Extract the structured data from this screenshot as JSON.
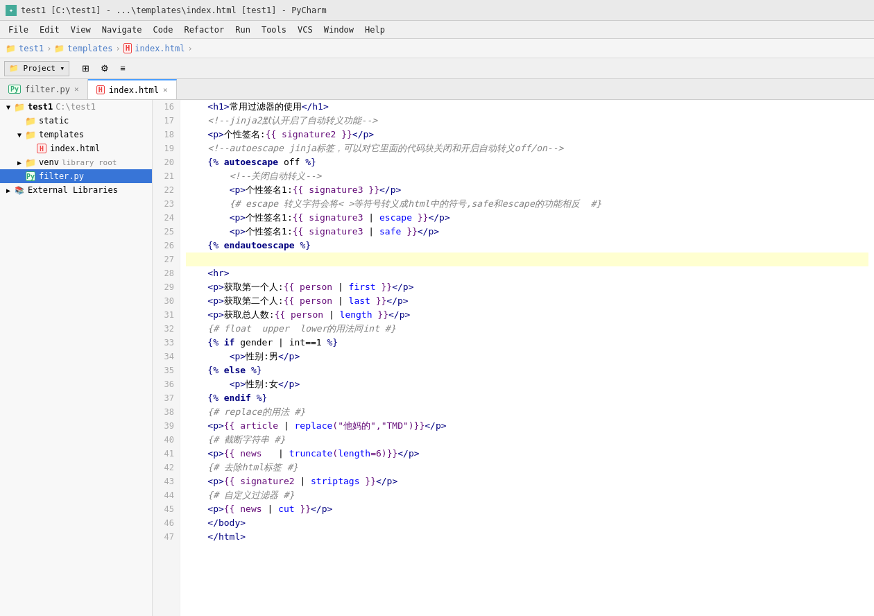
{
  "window": {
    "title": "test1 [C:\\test1] - ...\\templates\\index.html [test1] - PyCharm"
  },
  "menu": {
    "items": [
      "File",
      "Edit",
      "View",
      "Navigate",
      "Code",
      "Refactor",
      "Run",
      "Tools",
      "VCS",
      "Window",
      "Help"
    ]
  },
  "breadcrumbs": [
    "test1",
    "templates",
    "index.html"
  ],
  "toolbar": {
    "project_label": "Project",
    "tabs": [
      {
        "label": "filter.py",
        "active": false,
        "closable": true
      },
      {
        "label": "index.html",
        "active": true,
        "closable": true
      }
    ]
  },
  "sidebar": {
    "items": [
      {
        "indent": 0,
        "arrow": "▼",
        "icon": "folder",
        "label": "test1",
        "suffix": "C:\\test1",
        "selected": false
      },
      {
        "indent": 1,
        "arrow": "",
        "icon": "folder",
        "label": "static",
        "suffix": "",
        "selected": false
      },
      {
        "indent": 1,
        "arrow": "▼",
        "icon": "folder",
        "label": "templates",
        "suffix": "",
        "selected": false
      },
      {
        "indent": 2,
        "arrow": "",
        "icon": "html",
        "label": "index.html",
        "suffix": "",
        "selected": false
      },
      {
        "indent": 1,
        "arrow": "▶",
        "icon": "folder",
        "label": "venv",
        "suffix": "library root",
        "selected": false
      },
      {
        "indent": 1,
        "arrow": "",
        "icon": "py",
        "label": "filter.py",
        "suffix": "",
        "selected": true
      },
      {
        "indent": 0,
        "arrow": "▶",
        "icon": "libs",
        "label": "External Libraries",
        "suffix": "",
        "selected": false
      }
    ]
  },
  "code": {
    "lines": [
      {
        "num": 16,
        "content": "    <h1>常用过滤器的使用</h1>",
        "type": "html",
        "highlighted": false
      },
      {
        "num": 17,
        "content": "    <!--jinja2默认开启了自动转义功能-->",
        "type": "comment",
        "highlighted": false
      },
      {
        "num": 18,
        "content": "    <p>个性签名:{{ signature2 }}</p>",
        "type": "html",
        "highlighted": false
      },
      {
        "num": 19,
        "content": "    <!--autoescape jinja标签，可以对它里面的代码块关闭和开启自动转义off/on-->",
        "type": "comment",
        "highlighted": false
      },
      {
        "num": 20,
        "content": "    {% autoescape off %}",
        "type": "jinja",
        "highlighted": false
      },
      {
        "num": 21,
        "content": "        <!--关闭自动转义-->",
        "type": "comment",
        "highlighted": false
      },
      {
        "num": 22,
        "content": "        <p>个性签名1:{{ signature3 }}</p>",
        "type": "html",
        "highlighted": false
      },
      {
        "num": 23,
        "content": "        {# escape 转义字符会将< >等符号转义成html中的符号,safe和escape的功能相反  #}",
        "type": "comment",
        "highlighted": false
      },
      {
        "num": 24,
        "content": "        <p>个性签名1:{{ signature3 | escape }}</p>",
        "type": "html",
        "highlighted": false
      },
      {
        "num": 25,
        "content": "        <p>个性签名1:{{ signature3 | safe }}</p>",
        "type": "html",
        "highlighted": false
      },
      {
        "num": 26,
        "content": "    {% endautoescape %}",
        "type": "jinja",
        "highlighted": false
      },
      {
        "num": 27,
        "content": "",
        "type": "empty",
        "highlighted": true
      },
      {
        "num": 28,
        "content": "    <hr>",
        "type": "html",
        "highlighted": false
      },
      {
        "num": 29,
        "content": "    <p>获取第一个人:{{ person | first }}</p>",
        "type": "html",
        "highlighted": false
      },
      {
        "num": 30,
        "content": "    <p>获取第二个人:{{ person | last }}</p>",
        "type": "html",
        "highlighted": false
      },
      {
        "num": 31,
        "content": "    <p>获取总人数:{{ person | length }}</p>",
        "type": "html",
        "highlighted": false
      },
      {
        "num": 32,
        "content": "    {# float  upper  lower的用法同int #}",
        "type": "comment",
        "highlighted": false
      },
      {
        "num": 33,
        "content": "    {% if gender | int==1 %}",
        "type": "jinja",
        "highlighted": false
      },
      {
        "num": 34,
        "content": "        <p>性别:男</p>",
        "type": "html",
        "highlighted": false
      },
      {
        "num": 35,
        "content": "    {% else %}",
        "type": "jinja",
        "highlighted": false
      },
      {
        "num": 36,
        "content": "        <p>性别:女</p>",
        "type": "html",
        "highlighted": false
      },
      {
        "num": 37,
        "content": "    {% endif %}",
        "type": "jinja",
        "highlighted": false
      },
      {
        "num": 38,
        "content": "    {# replace的用法 #}",
        "type": "comment",
        "highlighted": false
      },
      {
        "num": 39,
        "content": "    <p>{{ article | replace(\"他妈的\",\"TMD\")}}</p>",
        "type": "html",
        "highlighted": false
      },
      {
        "num": 40,
        "content": "    {# 截断字符串 #}",
        "type": "comment",
        "highlighted": false
      },
      {
        "num": 41,
        "content": "    <p>{{ news   | truncate(length=6)}}</p>",
        "type": "html",
        "highlighted": false
      },
      {
        "num": 42,
        "content": "    {# 去除html标签 #}",
        "type": "comment",
        "highlighted": false
      },
      {
        "num": 43,
        "content": "    <p>{{ signature2 | striptags }}</p>",
        "type": "html",
        "highlighted": false
      },
      {
        "num": 44,
        "content": "    {# 自定义过滤器 #}",
        "type": "comment",
        "highlighted": false
      },
      {
        "num": 45,
        "content": "    <p>{{ news | cut }}</p>",
        "type": "html",
        "highlighted": false
      },
      {
        "num": 46,
        "content": "    </body>",
        "type": "html",
        "highlighted": false
      },
      {
        "num": 47,
        "content": "    </html>",
        "type": "html",
        "highlighted": false
      }
    ]
  }
}
